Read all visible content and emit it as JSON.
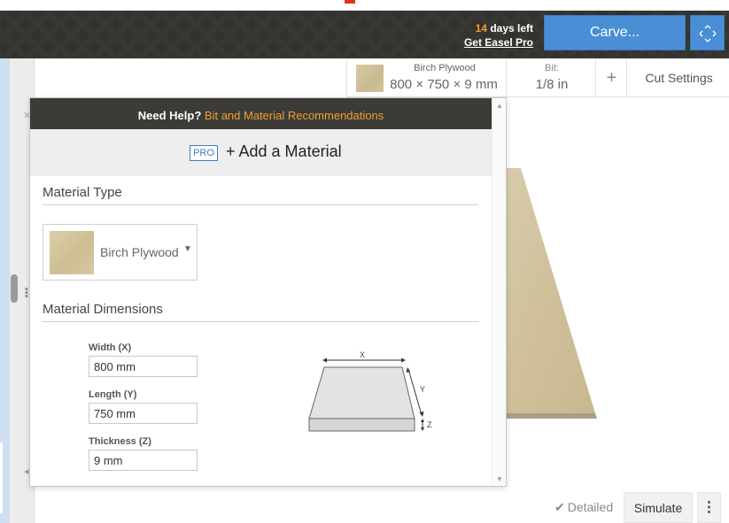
{
  "header": {
    "trial_days": "14",
    "trial_text": "days left",
    "get_pro": "Get Easel Pro",
    "carve_label": "Carve..."
  },
  "toolbar": {
    "material_name": "Birch Plywood",
    "material_dims": "800 × 750 × 9 mm",
    "bit_label": "Bit:",
    "bit_value": "1/8 in",
    "plus_label": "+",
    "cut_settings": "Cut Settings"
  },
  "dialog": {
    "help_prefix": "Need Help?",
    "help_link": "Bit and Material Recommendations",
    "pro_badge": "PRO",
    "add_material": "+ Add a Material",
    "material_type_heading": "Material Type",
    "material_type_value": "Birch Plywood",
    "dimensions_heading": "Material Dimensions",
    "width_label": "Width (X)",
    "width_value": "800 mm",
    "length_label": "Length (Y)",
    "length_value": "750 mm",
    "thickness_label": "Thickness (Z)",
    "thickness_value": "9 mm",
    "diagram_x": "X",
    "diagram_y": "Y",
    "diagram_z": "Z"
  },
  "footer": {
    "detailed_label": "Detailed",
    "simulate_label": "Simulate",
    "more_label": "⋮"
  },
  "colors": {
    "accent_blue": "#4a8fd6",
    "help_link_orange": "#f0a030",
    "header_dark": "#33322f"
  },
  "icons": {
    "expand": "expand-arrows-icon",
    "check": "check-icon",
    "caret": "caret-down-icon",
    "more": "kebab-menu-icon"
  }
}
